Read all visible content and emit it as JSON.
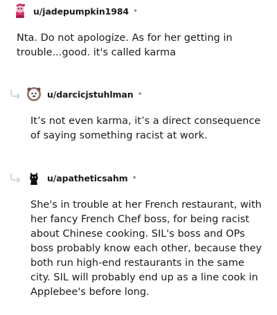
{
  "comments": [
    {
      "username": "u/jadepumpkin1984",
      "separator": "•",
      "avatar_icon": "pink-snoo-avatar-icon",
      "text": "Nta. Do not apologize. As for her getting in trouble...good. it's called karma"
    },
    {
      "username": "u/darcicjstuhlman",
      "separator": "•",
      "avatar_icon": "bear-snoo-avatar-icon",
      "reply_icon": "reply-arrow-icon",
      "text": "It’s not even karma, it’s a direct consequence of saying something racist at work."
    },
    {
      "username": "u/apatheticsahm",
      "separator": "•",
      "avatar_icon": "black-snoo-avatar-icon",
      "reply_icon": "reply-arrow-icon",
      "text": "She's in trouble at her French restaurant, with her fancy French Chef boss, for being racist about Chinese cooking. SIL's boss and OPs boss probably know each other, because they both run high-end restaurants in the same city. SIL will probably end up as a line cook in Applebee's before long."
    }
  ],
  "colors": {
    "text": "#1a1a1b",
    "meta": "#878a8c",
    "reply_arrow": "#c5cfd6",
    "background": "#ffffff"
  }
}
